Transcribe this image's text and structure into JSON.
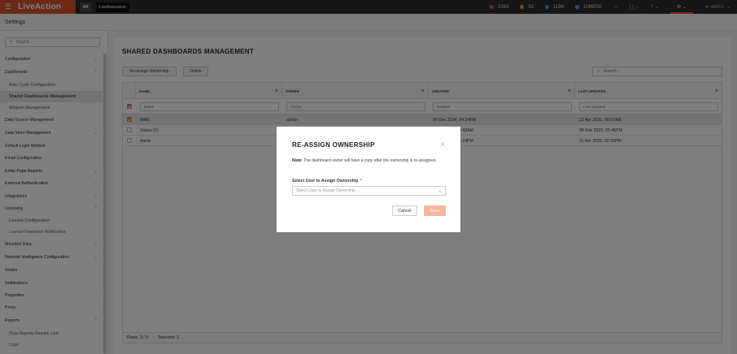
{
  "topbar": {
    "app_name": "LiveAction",
    "chips": [
      "NX",
      "LiveAssurance"
    ],
    "alerts": [
      {
        "count": "1363",
        "color": "#d9534f"
      },
      {
        "count": "92",
        "color": "#e69a2e"
      },
      {
        "count": "1196",
        "color": "#5b9bd5"
      }
    ],
    "users_count": "1089032",
    "user_name": "admin"
  },
  "settings_title": "Settings",
  "sidebar": {
    "search_placeholder": "Search...",
    "items": [
      {
        "label": "Configuration",
        "chevron": "⌄",
        "sub": false
      },
      {
        "label": "Dashboards",
        "chevron": "⌃",
        "sub": false
      },
      {
        "label": "Auto Cycle Configuration",
        "sub": true
      },
      {
        "label": "Shared Dashboards Management",
        "sub": true,
        "active": true
      },
      {
        "label": "Widgets Management",
        "sub": true
      },
      {
        "label": "Data Source Management",
        "sub": false
      },
      {
        "label": "Data Store Management",
        "chevron": "⌄",
        "sub": false
      },
      {
        "label": "Default Login Method",
        "sub": false
      },
      {
        "label": "Email Configuration",
        "sub": false
      },
      {
        "label": "Entity Page Reports",
        "chevron": "⌄",
        "sub": false
      },
      {
        "label": "External Authentication",
        "chevron": "⌄",
        "sub": false
      },
      {
        "label": "Integrations",
        "chevron": "⌄",
        "sub": false
      },
      {
        "label": "Licensing",
        "chevron": "⌃",
        "sub": false
      },
      {
        "label": "License Configuration",
        "sub": true
      },
      {
        "label": "License Expiration Notification",
        "sub": true
      },
      {
        "label": "Mounted Data",
        "chevron": "⌄",
        "sub": false
      },
      {
        "label": "Network Intelligence Configuration",
        "chevron": "⌄",
        "sub": false
      },
      {
        "label": "Nodes",
        "sub": false
      },
      {
        "label": "Notifications",
        "sub": false
      },
      {
        "label": "Properties",
        "chevron": "⌄",
        "sub": false
      },
      {
        "label": "Proxy",
        "sub": false
      },
      {
        "label": "Reports",
        "chevron": "⌃",
        "sub": false
      },
      {
        "label": "Flow Reports Results Limit",
        "sub": true
      },
      {
        "label": "Logo",
        "sub": true
      }
    ]
  },
  "main": {
    "title": "SHARED DASHBOARDS MANAGEMENT",
    "reassign_label": "Re-assign Ownership",
    "delete_label": "Delete",
    "search_placeholder": "Search...",
    "columns": [
      "NAME",
      "OWNER",
      "CREATED",
      "LAST UPDATED"
    ],
    "filters": [
      "Name",
      "Owner",
      "Created",
      "Last Updated"
    ],
    "rows": [
      {
        "name": "WAN",
        "owner": "admin",
        "created": "06 Dec 2024, 04:24PM",
        "updated": "23 Apr 2025, 08:57AM",
        "checked": true
      },
      {
        "name": "Status (2)",
        "owner": "",
        "created": "09:42AM",
        "updated": "08 Feb 2025, 05:46PM",
        "checked": false
      },
      {
        "name": "Alerts",
        "owner": "",
        "created": "04:24PM",
        "updated": "22 Apr 2025, 02:56PM",
        "checked": false
      }
    ],
    "footer_rows": "Rows: 3 / 3",
    "footer_selected": "Selected: 1"
  },
  "modal": {
    "title": "RE-ASSIGN OWNERSHIP",
    "note_label": "Note:",
    "note_text": "The dashboard owner will have a copy after the ownership is re-assigned.",
    "select_label": "Select User to Assign Ownership",
    "required_mark": "*",
    "select_placeholder": "Select User to Assign Ownership",
    "cancel_label": "Cancel",
    "save_label": "Save"
  }
}
